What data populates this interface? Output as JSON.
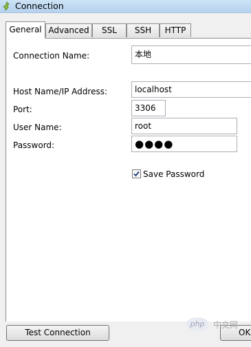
{
  "window": {
    "title": "Connection",
    "icon": "navicat-connection-icon"
  },
  "tabs": [
    {
      "label": "General",
      "active": true
    },
    {
      "label": "Advanced",
      "active": false
    },
    {
      "label": "SSL",
      "active": false
    },
    {
      "label": "SSH",
      "active": false
    },
    {
      "label": "HTTP",
      "active": false
    }
  ],
  "form": {
    "connection_name": {
      "label": "Connection Name:",
      "value": "本地"
    },
    "host": {
      "label": "Host Name/IP Address:",
      "value": "localhost"
    },
    "port": {
      "label": "Port:",
      "value": "3306"
    },
    "user": {
      "label": "User Name:",
      "value": "root"
    },
    "password": {
      "label": "Password:",
      "value": "●●●●"
    },
    "save_password": {
      "label": "Save Password",
      "checked": true
    }
  },
  "buttons": {
    "test_connection": "Test Connection",
    "ok": "OK"
  },
  "watermark": {
    "logo": "php",
    "text": "中文网"
  }
}
